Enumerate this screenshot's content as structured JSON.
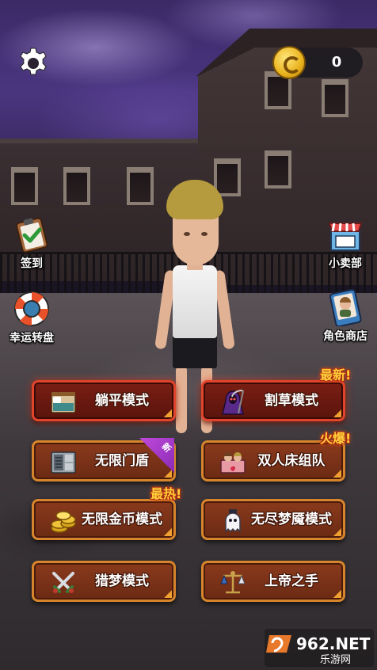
{
  "hud": {
    "coin_count": "0"
  },
  "side_buttons": {
    "checkin": {
      "label": "签到",
      "icon": "checkin-clipboard-icon"
    },
    "lucky_wheel": {
      "label": "幸运转盘",
      "icon": "lifebuoy-wheel-icon"
    },
    "shop": {
      "label": "小卖部",
      "icon": "shop-stall-icon"
    },
    "character_shop": {
      "label": "角色商店",
      "icon": "character-portrait-icon"
    }
  },
  "modes": [
    {
      "label": "躺平模式",
      "icon": "bed-icon",
      "style": "red"
    },
    {
      "label": "割草模式",
      "icon": "reaper-icon",
      "style": "red",
      "tag": "最新!"
    },
    {
      "label": "无限门盾",
      "icon": "door-shield-icon",
      "style": "normal",
      "ribbon": "新"
    },
    {
      "label": "双人床组队",
      "icon": "double-bed-icon",
      "style": "normal",
      "tag": "火爆!"
    },
    {
      "label": "无限金币模式",
      "icon": "gold-coins-icon",
      "style": "normal",
      "tag": "最热!"
    },
    {
      "label": "无尽梦魇模式",
      "icon": "ghost-icon",
      "style": "normal"
    },
    {
      "label": "猎梦模式",
      "icon": "crossed-swords-icon",
      "style": "normal"
    },
    {
      "label": "上帝之手",
      "icon": "scales-icon",
      "style": "normal"
    }
  ],
  "watermark": {
    "logo": "962.NET",
    "subtitle": "乐游网"
  },
  "colors": {
    "button_border": "#d6852c",
    "button_red_border": "#e0442a",
    "tag_text": "#ffcf3a",
    "coin_gold": "#e9b21c",
    "new_ribbon": "#a63ac8"
  }
}
